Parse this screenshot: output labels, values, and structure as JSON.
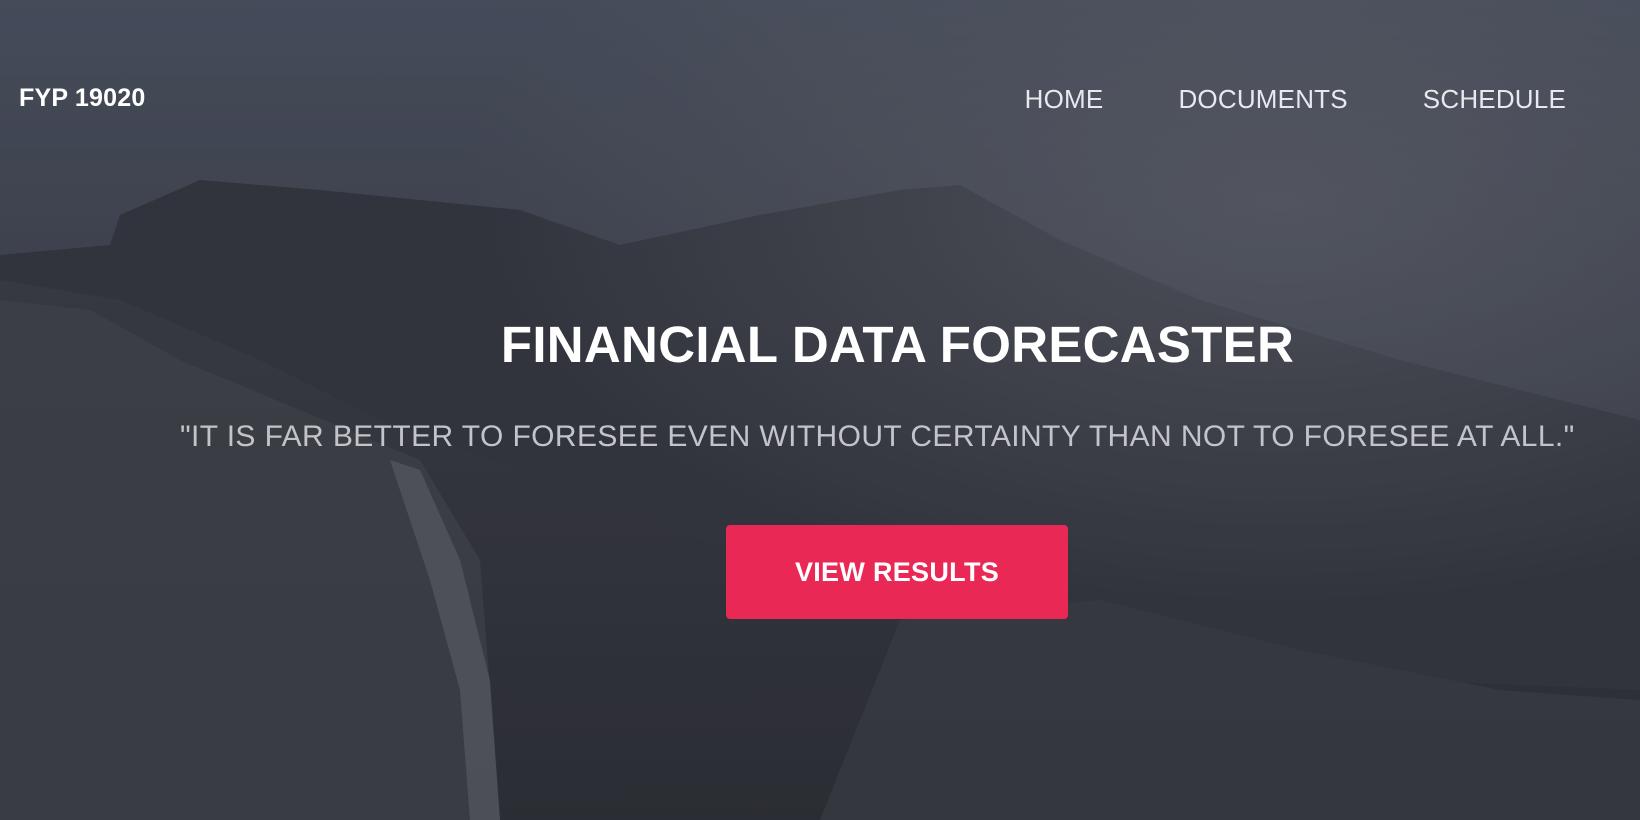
{
  "brand": {
    "name": "FYP 19020"
  },
  "nav": {
    "items": [
      {
        "label": "HOME"
      },
      {
        "label": "DOCUMENTS"
      },
      {
        "label": "SCHEDULE"
      }
    ]
  },
  "hero": {
    "title": "FINANCIAL DATA FORECASTER",
    "quote": "\"IT IS FAR BETTER TO FORESEE EVEN WITHOUT CERTAINTY THAN NOT TO FORESEE AT ALL.\"",
    "cta_label": "VIEW RESULTS"
  },
  "colors": {
    "accent": "#ea2855",
    "background": "#3a3c45",
    "text": "#ffffff"
  }
}
